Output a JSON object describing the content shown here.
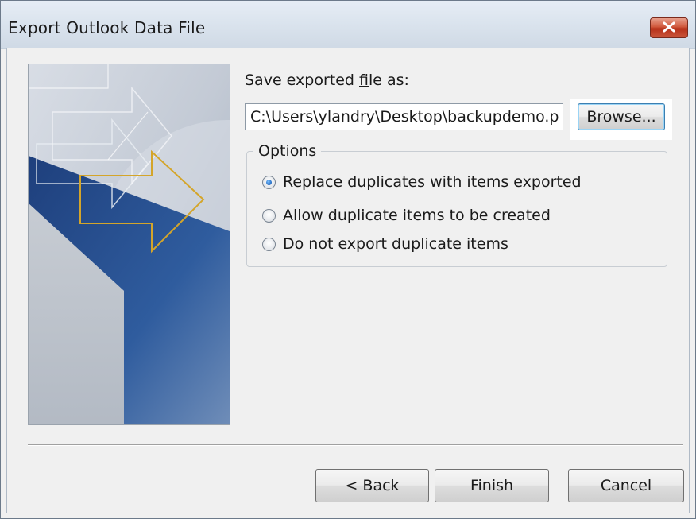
{
  "window": {
    "title": "Export Outlook Data File",
    "close_icon": "close-x-icon"
  },
  "file": {
    "label": "Save exported file as:",
    "path_value": "C:\\Users\\ylandry\\Desktop\\backupdemo.p",
    "browse_label": "Browse..."
  },
  "options": {
    "legend": "Options",
    "items": [
      {
        "label": "Replace duplicates with items exported",
        "checked": true
      },
      {
        "label": "Allow duplicate items to be created",
        "checked": false
      },
      {
        "label": "Do not export duplicate items",
        "checked": false
      }
    ]
  },
  "buttons": {
    "back": "< Back",
    "finish": "Finish",
    "cancel": "Cancel"
  },
  "colors": {
    "close": "#c9553b",
    "wizard_blue": "#2a5394",
    "wizard_gold": "#d4a52a"
  }
}
